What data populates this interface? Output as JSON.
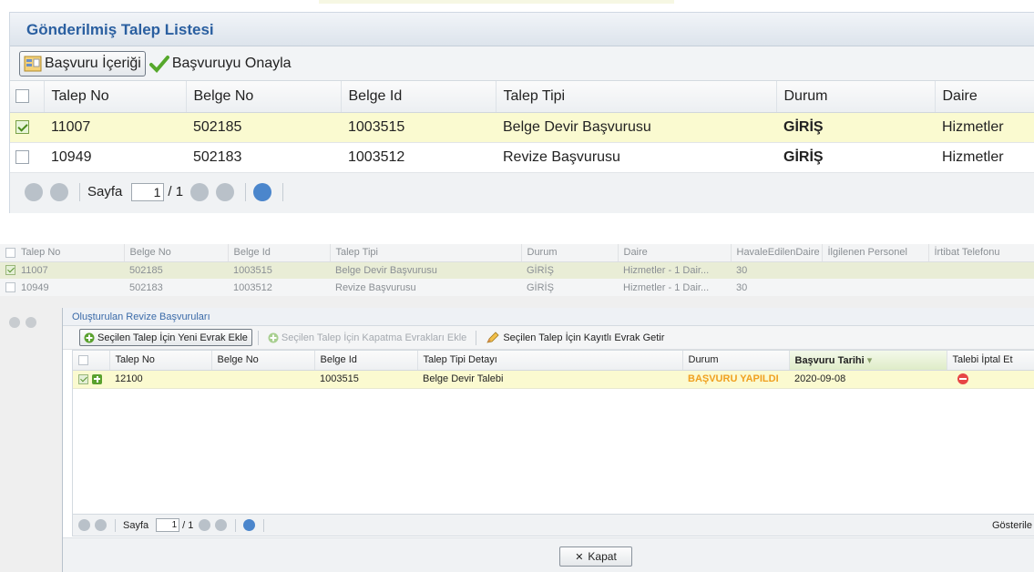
{
  "panel1": {
    "title": "Gönderilmiş Talep Listesi",
    "toolbar": {
      "content_button": "Başvuru İçeriği",
      "approve_button": "Başvuruyu Onayla"
    },
    "columns": [
      "Talep No",
      "Belge No",
      "Belge Id",
      "Talep Tipi",
      "Durum",
      "Daire"
    ],
    "rows": [
      {
        "talep_no": "11007",
        "belge_no": "502185",
        "belge_id": "1003515",
        "talep_tipi": "Belge Devir Başvurusu",
        "durum": "GİRİŞ",
        "daire": "Hizmetler",
        "checked": true
      },
      {
        "talep_no": "10949",
        "belge_no": "502183",
        "belge_id": "1003512",
        "talep_tipi": "Revize Başvurusu",
        "durum": "GİRİŞ",
        "daire": "Hizmetler",
        "checked": false
      }
    ],
    "pager": {
      "label": "Sayfa",
      "page": "1",
      "total": "/ 1"
    }
  },
  "background_grid": {
    "columns": [
      "Talep No",
      "Belge No",
      "Belge Id",
      "Talep Tipi",
      "Durum",
      "Daire",
      "HavaleEdilenDaire",
      "İlgilenen Personel",
      "İrtibat Telefonu"
    ],
    "rows": [
      {
        "talep_no": "11007",
        "belge_no": "502185",
        "belge_id": "1003515",
        "talep_tipi": "Belge Devir Başvurusu",
        "durum": "GİRİŞ",
        "daire": "Hizmetler - 1 Dair...",
        "havale": "30"
      },
      {
        "talep_no": "10949",
        "belge_no": "502183",
        "belge_id": "1003512",
        "talep_tipi": "Revize Başvurusu",
        "durum": "GİRİŞ",
        "daire": "Hizmetler - 1 Dair...",
        "havale": "30"
      }
    ]
  },
  "dialog": {
    "title": "Oluşturulan Revize Başvuruları",
    "toolbar": {
      "add_doc": "Seçilen Talep İçin Yeni Evrak Ekle",
      "add_closing_doc": "Seçilen Talep İçin Kapatma Evrakları Ekle",
      "get_saved_doc": "Seçilen Talep İçin Kayıtlı Evrak Getir"
    },
    "columns": [
      "Talep No",
      "Belge No",
      "Belge Id",
      "Talep Tipi Detayı",
      "Durum",
      "Başvuru Tarihi",
      "Talebi İptal Et"
    ],
    "rows": [
      {
        "talep_no": "12100",
        "belge_no": "",
        "belge_id": "1003515",
        "detay": "Belge Devir Talebi",
        "durum": "BAŞVURU YAPILDI",
        "tarih": "2020-09-08"
      }
    ],
    "pager": {
      "label": "Sayfa",
      "page": "1",
      "total": "/ 1",
      "right_text": "Gösterile"
    },
    "close_button": "Kapat"
  },
  "colors": {
    "title_blue": "#2a5fa0",
    "selected_row": "#fafad0",
    "status_orange": "#f0a020",
    "cancel_red": "#e74545",
    "add_green": "#5aa12e"
  }
}
